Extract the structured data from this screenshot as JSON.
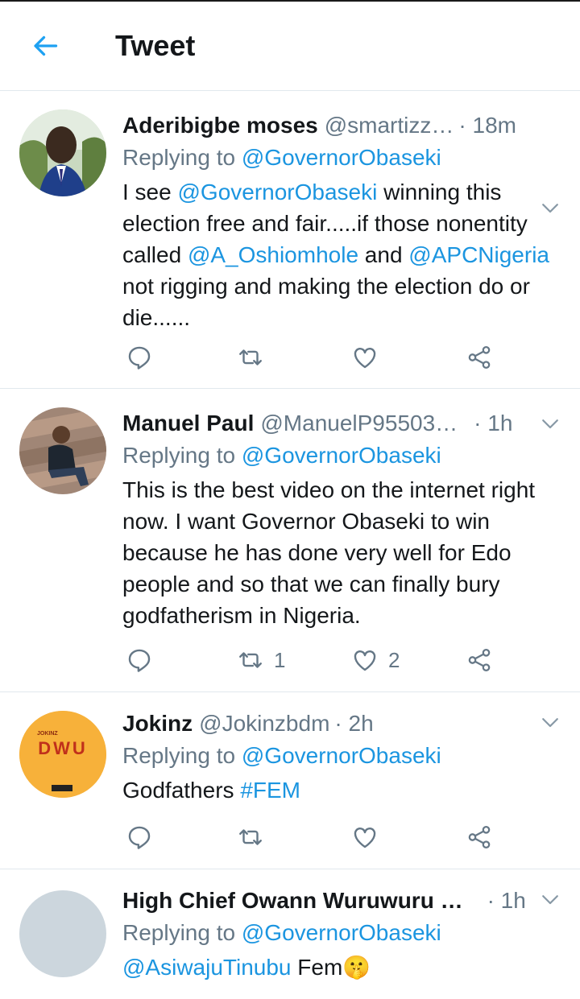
{
  "header": {
    "title": "Tweet"
  },
  "colors": {
    "link": "#1b95e0",
    "muted": "#657786",
    "text": "#14171a",
    "divider": "#e1e8ed"
  },
  "tweets": [
    {
      "name": "Aderibigbe moses",
      "handle": "@smartizz…",
      "time": "· 18m",
      "replying_prefix": "Replying to",
      "replying_to": "@GovernorObaseki",
      "body_segments": [
        {
          "t": "I see "
        },
        {
          "t": "@GovernorObaseki",
          "link": true
        },
        {
          "t": "  winning this election free and fair.....if those nonentity called "
        },
        {
          "t": "@A_Oshiomhole",
          "link": true
        },
        {
          "t": "  and "
        },
        {
          "t": "@APCNigeria",
          "link": true
        },
        {
          "t": "  not rigging and making the election do or die......"
        }
      ],
      "retweets": "",
      "likes": ""
    },
    {
      "name": "Manuel Paul",
      "handle": "@ManuelP95503…",
      "time": "· 1h",
      "replying_prefix": "Replying to",
      "replying_to": "@GovernorObaseki",
      "body_segments": [
        {
          "t": "This is the best video on the internet right now. I want Governor Obaseki to win because he has done very well for Edo people and so that we can finally bury godfatherism in Nigeria."
        }
      ],
      "retweets": "1",
      "likes": "2"
    },
    {
      "name": "Jokinz",
      "handle": "@Jokinzbdm",
      "time": "· 2h",
      "replying_prefix": "Replying to",
      "replying_to": "@GovernorObaseki",
      "body_segments": [
        {
          "t": "Godfathers "
        },
        {
          "t": "#FEM",
          "link": true
        }
      ],
      "retweets": "",
      "likes": ""
    },
    {
      "name": "High Chief Owann Wuruwuru …",
      "handle": "",
      "time": "· 1h",
      "replying_prefix": "Replying to",
      "replying_to": "@GovernorObaseki",
      "body_segments": [
        {
          "t": "@AsiwajuTinubu",
          "link": true
        },
        {
          "t": " Fem"
        },
        {
          "t": "🤫"
        }
      ],
      "retweets": "",
      "likes": ""
    }
  ],
  "avatar_logo_text": {
    "small": "JOKINZ",
    "big": "DWU"
  },
  "icons": [
    "back-arrow-icon",
    "reply-icon",
    "retweet-icon",
    "like-icon",
    "share-icon",
    "chevron-down-icon"
  ]
}
